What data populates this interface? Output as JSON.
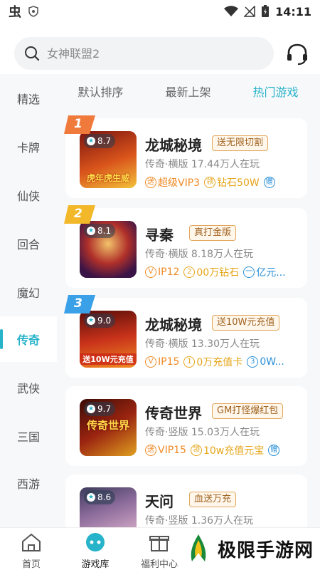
{
  "status_bar": {
    "time": "14:11",
    "app_glyph": "虫"
  },
  "search": {
    "placeholder": "女神联盟2"
  },
  "sidebar": {
    "items": [
      {
        "label": "精选"
      },
      {
        "label": "卡牌"
      },
      {
        "label": "仙侠"
      },
      {
        "label": "回合"
      },
      {
        "label": "魔幻"
      },
      {
        "label": "传奇"
      },
      {
        "label": "武侠"
      },
      {
        "label": "三国"
      },
      {
        "label": "西游"
      }
    ],
    "active_index": 5
  },
  "tabs": [
    {
      "label": "默认排序"
    },
    {
      "label": "最新上架"
    },
    {
      "label": "热门游戏"
    }
  ],
  "games": [
    {
      "rank": "1",
      "score": "8.7",
      "name": "龙城秘境",
      "tag": "送无限切割",
      "meta": "传奇·横版  17.44万人在玩",
      "thumb_text": "虎年虎生威",
      "perks": [
        {
          "icon": "送",
          "text": "超级VIP3",
          "color": "orange"
        },
        {
          "icon": "领",
          "text": "钻石50W",
          "color": "gold"
        },
        {
          "icon": "赠",
          "text": "",
          "color": "blue"
        }
      ]
    },
    {
      "rank": "2",
      "score": "8.1",
      "name": "寻秦",
      "tag": "真打金版",
      "meta": "传奇·横版  8.18万人在玩",
      "thumb_text": "",
      "perks": [
        {
          "icon": "V",
          "text": "IP12",
          "color": "orange"
        },
        {
          "icon": "2",
          "text": "00万钻石",
          "color": "gold"
        },
        {
          "icon": "一",
          "text": "亿元...",
          "color": "blue"
        }
      ]
    },
    {
      "rank": "3",
      "score": "9.0",
      "name": "龙城秘境",
      "tag": "送10W元充值",
      "meta": "传奇·横版  13.30万人在玩",
      "thumb_text": "送10W元充值",
      "perks": [
        {
          "icon": "V",
          "text": "IP15",
          "color": "orange"
        },
        {
          "icon": "1",
          "text": "0万充值卡",
          "color": "gold"
        },
        {
          "icon": "3",
          "text": "0W...",
          "color": "blue"
        }
      ]
    },
    {
      "rank": "",
      "score": "9.7",
      "name": "传奇世界",
      "tag": "GM打怪爆红包",
      "meta": "传奇·竖版  15.03万人在玩",
      "thumb_text": "传奇世界",
      "perks": [
        {
          "icon": "送",
          "text": "VIP15",
          "color": "orange"
        },
        {
          "icon": "领",
          "text": "10w充值元宝",
          "color": "gold"
        },
        {
          "icon": "赠",
          "text": "",
          "color": "blue"
        }
      ]
    },
    {
      "rank": "",
      "score": "8.6",
      "name": "天问",
      "tag": "血送万充",
      "meta": "传奇·竖版  1.36万人在玩",
      "thumb_text": "",
      "perks": []
    }
  ],
  "bottom_nav": [
    {
      "label": "首页"
    },
    {
      "label": "游戏库"
    },
    {
      "label": "福利中心"
    }
  ],
  "watermark": {
    "text": "极限手游网"
  },
  "colors": {
    "accent": "#27b3c9",
    "rank1": "#f07a3c",
    "rank2": "#f2b82a",
    "rank3": "#3aa0e8"
  }
}
